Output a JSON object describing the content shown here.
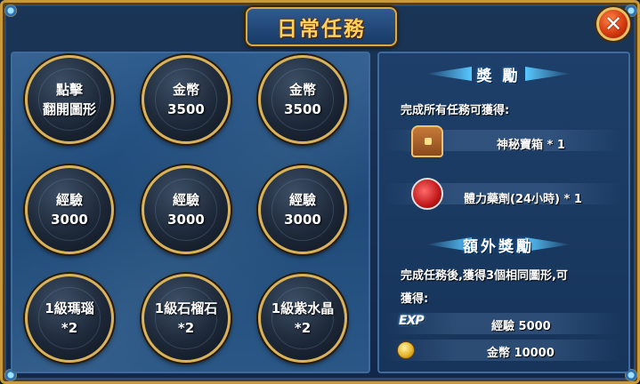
{
  "window": {
    "title": "日常任務",
    "close_label": "✕"
  },
  "tasks": [
    {
      "line1": "點擊",
      "line2": "翻開圖形"
    },
    {
      "line1": "金幣",
      "line2": "3500"
    },
    {
      "line1": "金幣",
      "line2": "3500"
    },
    {
      "line1": "經驗",
      "line2": "3000"
    },
    {
      "line1": "經驗",
      "line2": "3000"
    },
    {
      "line1": "經驗",
      "line2": "3000"
    },
    {
      "line1": "1級瑪瑙",
      "line2": "*2"
    },
    {
      "line1": "1級石榴石",
      "line2": "*2"
    },
    {
      "line1": "1級紫水晶",
      "line2": "*2"
    }
  ],
  "rewards": {
    "header": "獎 勵",
    "intro": "完成所有任務可獲得:",
    "items": [
      {
        "icon": "treasure-chest-icon",
        "label": "神秘寶箱 * 1"
      },
      {
        "icon": "stamina-potion-icon",
        "label": "體力藥劑(24小時) * 1"
      }
    ]
  },
  "bonus": {
    "header": "額外獎勵",
    "desc_line1": "完成任務後,獲得3個相同圖形,可",
    "desc_line2": "獲得:",
    "exp_icon_text": "EXP",
    "items": [
      {
        "icon": "exp-icon",
        "label": "經驗 5000"
      },
      {
        "icon": "gold-coin-icon",
        "label": "金幣 10000"
      }
    ]
  },
  "colors": {
    "frame_gold": "#c89a3a",
    "title": "#ffd15a",
    "panel_blue": "#2b5a8c",
    "close_red": "#d63a10"
  }
}
